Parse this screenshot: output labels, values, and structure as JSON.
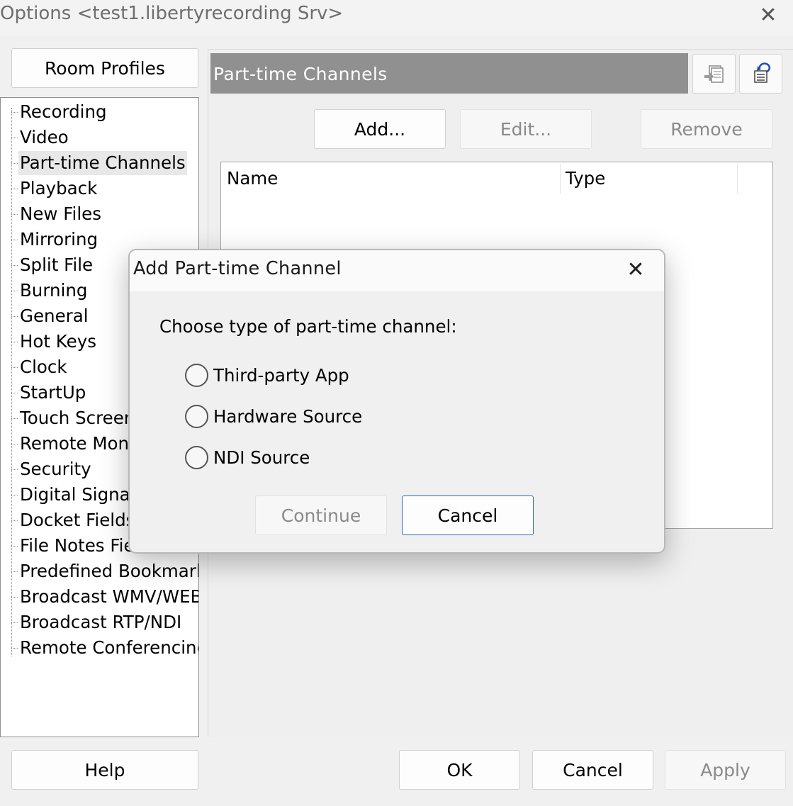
{
  "window": {
    "title": "Options <test1.libertyrecording  Srv>",
    "close_glyph": "✕"
  },
  "sidebar": {
    "room_profiles_label": "Room Profiles",
    "items": [
      {
        "label": "Recording"
      },
      {
        "label": "Video"
      },
      {
        "label": "Part-time Channels",
        "selected": true
      },
      {
        "label": "Playback"
      },
      {
        "label": "New Files"
      },
      {
        "label": "Mirroring"
      },
      {
        "label": "Split File"
      },
      {
        "label": "Burning"
      },
      {
        "label": "General"
      },
      {
        "label": "Hot Keys"
      },
      {
        "label": "Clock"
      },
      {
        "label": "StartUp"
      },
      {
        "label": "Touch Screen"
      },
      {
        "label": "Remote Monitoring"
      },
      {
        "label": "Security"
      },
      {
        "label": "Digital Signature"
      },
      {
        "label": "Docket Fields"
      },
      {
        "label": "File Notes Fields"
      },
      {
        "label": "Predefined Bookmarks"
      },
      {
        "label": "Broadcast WMV/WEB"
      },
      {
        "label": "Broadcast RTP/NDI"
      },
      {
        "label": "Remote Conferencing"
      }
    ]
  },
  "main": {
    "section_title": "Part-time Channels",
    "toolbar_icons": [
      "import-icon",
      "restore-icon"
    ],
    "add_label": "Add...",
    "edit_label": "Edit...",
    "remove_label": "Remove",
    "columns": [
      "Name",
      "Type"
    ]
  },
  "dialog": {
    "title": "Add Part-time Channel",
    "close_glyph": "✕",
    "prompt": "Choose type of part-time channel:",
    "options": [
      "Third-party App",
      "Hardware Source",
      "NDI Source"
    ],
    "continue_label": "Continue",
    "cancel_label": "Cancel"
  },
  "footer": {
    "help_label": "Help",
    "ok_label": "OK",
    "cancel_label": "Cancel",
    "apply_label": "Apply"
  },
  "colors": {
    "section_header_bg": "#909090",
    "dialog_focus_border": "#2b6ab0",
    "disabled_text": "#8a8a8a"
  }
}
